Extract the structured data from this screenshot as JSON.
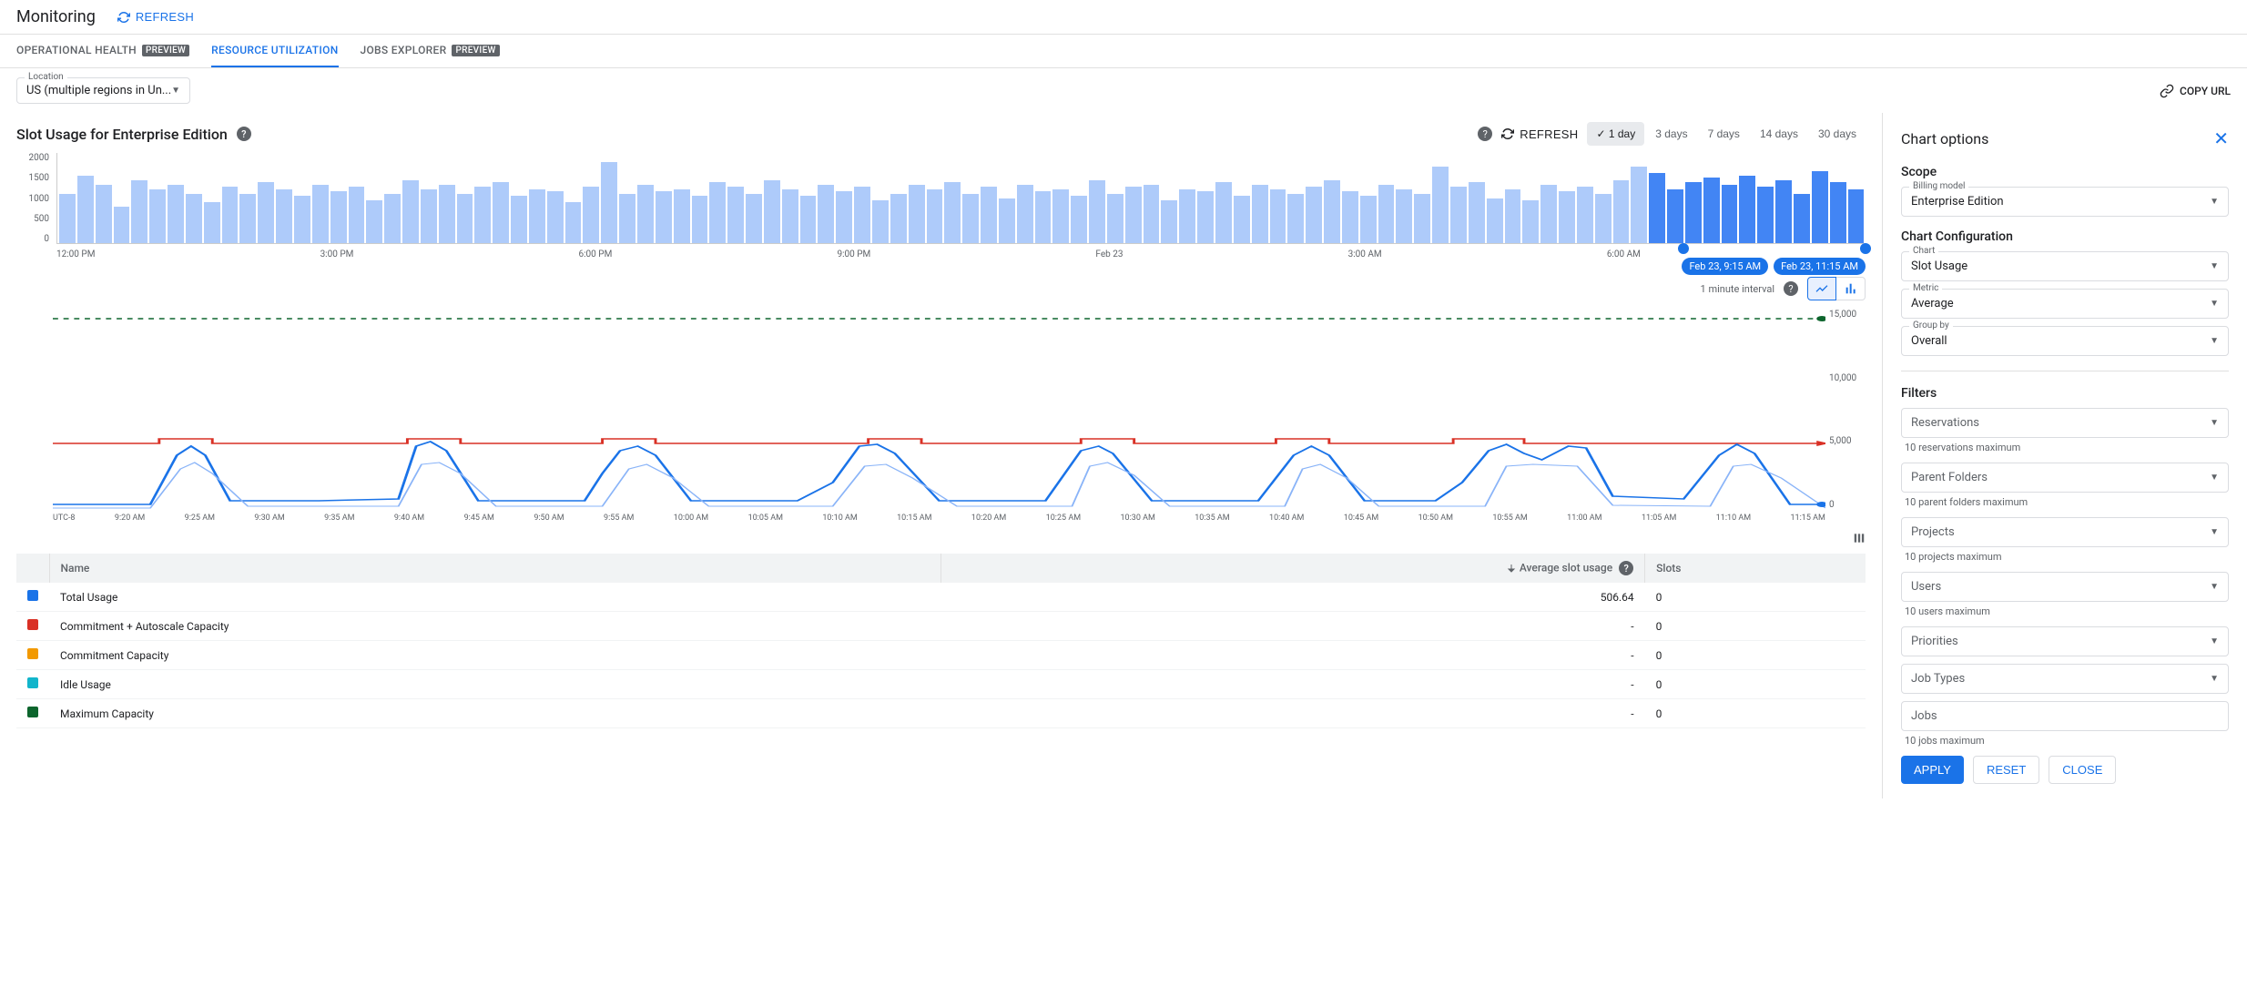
{
  "header": {
    "title": "Monitoring",
    "refresh": "REFRESH"
  },
  "tabs": [
    {
      "label": "OPERATIONAL HEALTH",
      "badge": "PREVIEW",
      "active": false
    },
    {
      "label": "RESOURCE UTILIZATION",
      "badge": null,
      "active": true
    },
    {
      "label": "JOBS EXPLORER",
      "badge": "PREVIEW",
      "active": false
    }
  ],
  "location": {
    "label": "Location",
    "value": "US (multiple regions in Un..."
  },
  "copy_url": "COPY URL",
  "section": {
    "title": "Slot Usage for Enterprise Edition",
    "refresh": "REFRESH",
    "ranges": [
      "1 day",
      "3 days",
      "7 days",
      "14 days",
      "30 days"
    ],
    "active_range": "1 day",
    "interval": "1 minute interval",
    "brush_start": "Feb 23, 9:15 AM",
    "brush_end": "Feb 23, 11:15 AM"
  },
  "chart_data": [
    {
      "type": "bar",
      "name": "overview",
      "y_ticks": [
        "2000",
        "1500",
        "1000",
        "500",
        "0"
      ],
      "x_ticks": [
        "12:00 PM",
        "3:00 PM",
        "6:00 PM",
        "9:00 PM",
        "Feb 23",
        "3:00 AM",
        "6:00 AM",
        ""
      ],
      "ylim": [
        0,
        2000
      ],
      "values": [
        1100,
        1500,
        1300,
        800,
        1400,
        1200,
        1300,
        1100,
        900,
        1250,
        1100,
        1350,
        1200,
        1050,
        1300,
        1150,
        1250,
        950,
        1100,
        1400,
        1200,
        1300,
        1100,
        1250,
        1350,
        1050,
        1200,
        1150,
        900,
        1250,
        1800,
        1100,
        1300,
        1150,
        1200,
        1050,
        1350,
        1250,
        1100,
        1400,
        1200,
        1050,
        1300,
        1150,
        1250,
        950,
        1100,
        1300,
        1200,
        1350,
        1100,
        1250,
        1000,
        1300,
        1150,
        1200,
        1050,
        1400,
        1100,
        1250,
        1300,
        950,
        1200,
        1150,
        1350,
        1050,
        1300,
        1200,
        1100,
        1250,
        1400,
        1150,
        1050,
        1300,
        1200,
        1100,
        1700,
        1250,
        1350,
        1000,
        1200,
        950,
        1300,
        1150,
        1250,
        1100,
        1400,
        1700,
        1550,
        1200,
        1350,
        1450,
        1300,
        1500,
        1250,
        1400,
        1100,
        1600,
        1350,
        1200
      ],
      "selected_from": 88
    },
    {
      "type": "line",
      "name": "detail",
      "y_ticks": [
        "15,000",
        "10,000",
        "5,000",
        "0"
      ],
      "ylim": [
        0,
        15000
      ],
      "x_ticks": [
        "UTC-8",
        "9:20 AM",
        "9:25 AM",
        "9:30 AM",
        "9:35 AM",
        "9:40 AM",
        "9:45 AM",
        "9:50 AM",
        "9:55 AM",
        "10:00 AM",
        "10:05 AM",
        "10:10 AM",
        "10:15 AM",
        "10:20 AM",
        "10:25 AM",
        "10:30 AM",
        "10:35 AM",
        "10:40 AM",
        "10:45 AM",
        "10:50 AM",
        "10:55 AM",
        "11:00 AM",
        "11:05 AM",
        "11:10 AM",
        "11:15 AM"
      ],
      "series": [
        {
          "name": "Maximum Capacity",
          "color": "#0d652d",
          "values": "constant 15000 (dotted)"
        },
        {
          "name": "Commitment + Autoscale Capacity",
          "color": "#d93025",
          "values": "mostly 5000 with brief steps to ~5300 every ~10min"
        },
        {
          "name": "Total Usage",
          "color": "#1a73e8",
          "values": "periodic spikes ~every 10 min up to ~4500, baseline ~500"
        },
        {
          "name": "Commitment Capacity",
          "color": "#f29900",
          "values": "~0"
        },
        {
          "name": "Idle Usage",
          "color": "#12b5cb",
          "values": "~0"
        }
      ]
    }
  ],
  "table": {
    "headers": [
      "",
      "Name",
      "Average slot usage",
      "Slots"
    ],
    "rows": [
      {
        "color": "#1a73e8",
        "name": "Total Usage",
        "avg": "506.64",
        "slots": "0"
      },
      {
        "color": "#d93025",
        "name": "Commitment + Autoscale Capacity",
        "avg": "-",
        "slots": "0"
      },
      {
        "color": "#f29900",
        "name": "Commitment Capacity",
        "avg": "-",
        "slots": "0"
      },
      {
        "color": "#12b5cb",
        "name": "Idle Usage",
        "avg": "-",
        "slots": "0"
      },
      {
        "color": "#0d652d",
        "name": "Maximum Capacity",
        "avg": "-",
        "slots": "0"
      }
    ]
  },
  "sidebar": {
    "title": "Chart options",
    "scope": {
      "title": "Scope",
      "billing_label": "Billing model",
      "billing_value": "Enterprise Edition"
    },
    "config": {
      "title": "Chart Configuration",
      "chart_label": "Chart",
      "chart_value": "Slot Usage",
      "metric_label": "Metric",
      "metric_value": "Average",
      "group_label": "Group by",
      "group_value": "Overall"
    },
    "filters": {
      "title": "Filters",
      "reservations": "Reservations",
      "reservations_hint": "10 reservations maximum",
      "parent": "Parent Folders",
      "parent_hint": "10 parent folders maximum",
      "projects": "Projects",
      "projects_hint": "10 projects maximum",
      "users": "Users",
      "users_hint": "10 users maximum",
      "priorities": "Priorities",
      "job_types": "Job Types",
      "jobs": "Jobs",
      "jobs_hint": "10 jobs maximum"
    },
    "buttons": {
      "apply": "APPLY",
      "reset": "RESET",
      "close": "CLOSE"
    }
  }
}
